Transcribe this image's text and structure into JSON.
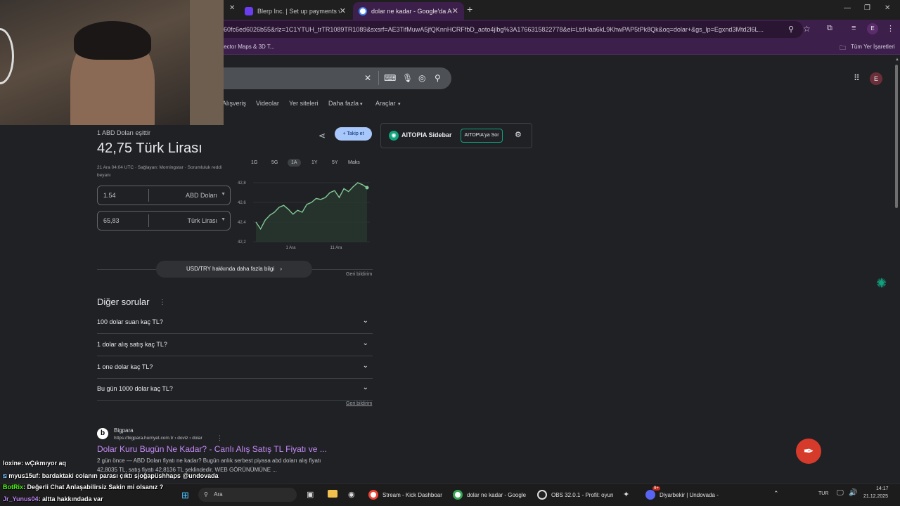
{
  "browser": {
    "tabs": [
      {
        "title": "Blerp Inc. | Set up payments wit",
        "active": false
      },
      {
        "title": "dolar ne kadar - Google'da Ara",
        "active": true
      }
    ],
    "url": "60fc6ed6026b55&rlz=1C1YTUH_trTR1089TR1089&sxsrf=AE3TifMuwA5jfQKnnHCRFfbD_aoto4jlbg%3A1766315822778&ei=LtdHaa6kL9KhwPAP5tPk8Qk&oq=dolar+&gs_lp=Egxnd3Mtd2l6L...",
    "bookmarks": {
      "left": "/ector Maps & 3D T...",
      "right": "Tüm Yer İşaretleri"
    },
    "avatar_letter": "E",
    "accent": "#3c1f4a"
  },
  "search": {
    "nav_tabs": [
      "Alışveriş",
      "Videolar",
      "Yer siteleri",
      "Daha fazla",
      "Araçlar"
    ]
  },
  "currency": {
    "equals_label": "1 ABD Doları eşittir",
    "result": "42,75 Türk Lirası",
    "meta": "21 Ara 04:04 UTC · Sağlayan: Morningstar · Sorumluluk reddi beyanı",
    "from_value": "1.54",
    "from_unit": "ABD Doları",
    "to_value": "65,83",
    "to_unit": "Türk Lirası",
    "follow_label": "Takip et",
    "ranges": [
      "1G",
      "5G",
      "1A",
      "1Y",
      "5Y",
      "Maks"
    ],
    "selected_range": "1A",
    "more_info": "USD/TRY hakkında daha fazla bilgi",
    "feedback": "Geri bildirim"
  },
  "chart_data": {
    "type": "line",
    "title": "",
    "xlabel": "",
    "ylabel": "",
    "ylim": [
      42.2,
      42.8
    ],
    "yticks": [
      "42,8",
      "42,6",
      "42,4",
      "42,2"
    ],
    "xticks": [
      "1 Ara",
      "11 Ara"
    ],
    "series": [
      {
        "values": [
          42.4,
          42.33,
          42.42,
          42.47,
          42.5,
          42.55,
          42.57,
          42.53,
          42.48,
          42.52,
          42.5,
          42.58,
          42.6,
          42.64,
          42.63,
          42.65,
          42.7,
          42.72,
          42.65,
          42.74,
          42.71,
          42.76,
          42.8,
          42.78,
          42.75
        ]
      }
    ]
  },
  "people_also_ask": {
    "heading": "Diğer sorular",
    "questions": [
      "100 dolar suan kaç TL?",
      "1 dolar alış satış kaç TL?",
      "1 one dolar kaç TL?",
      "Bu gün 1000 dolar kaç TL?"
    ],
    "feedback": "Geri bildirim"
  },
  "result": {
    "site": "Bigpara",
    "breadcrumb": "https://bigpara.hurriyet.com.tr › doviz › dolar",
    "title": "Dolar Kuru Bugün Ne Kadar? - Canlı Alış Satış TL Fiyatı ve ...",
    "snippet1": "2 gün önce — ABD Doları fiyatı ne kadar? Bugün anlık serbest piyasa abd doları alış fiyatı",
    "snippet2": "42,8035 TL, satış fiyatı 42,8136 TL şeklindedir. WEB GÖRÜNÜMÜNE ..."
  },
  "aitopia": {
    "title": "AITOPIA Sidebar",
    "ask": "AITOPIA'ya Sor"
  },
  "chat": [
    {
      "user": "loxine",
      "text": ": wÇıkmıyor aq"
    },
    {
      "user": "myus15uf",
      "text": ": bardaktaki colanın parası çıktı sjoğapüshhaps @undovada"
    },
    {
      "user": "BotRix",
      "text": ": Değerli Chat Anlaşabilirsiz Sakin mi olsanız ?"
    },
    {
      "user": "Jr_Yunus04",
      "text": ": altta hakkındada var"
    }
  ],
  "taskbar": {
    "search": "Ara",
    "items": [
      "Stream - Kick Dashboar",
      "dolar ne kadar - Google",
      "OBS 32.0.1 - Profil: oyun",
      "Diyarbekir | Undovada -"
    ],
    "lang": "TUR",
    "time": "14:17",
    "date": "21.12.2025",
    "discord_badge": "9+"
  }
}
